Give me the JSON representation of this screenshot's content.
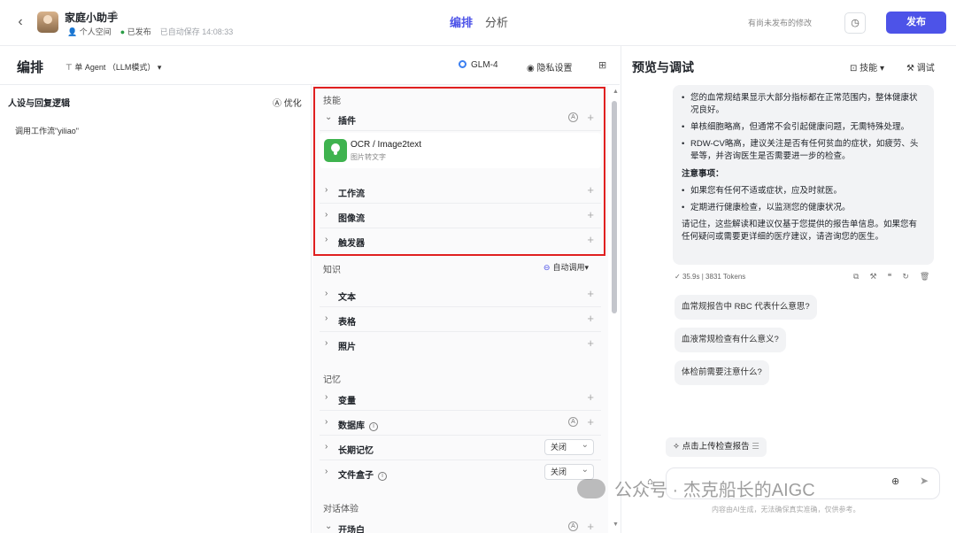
{
  "header": {
    "bot_name": "家庭小助手",
    "space": "个人空间",
    "status": "已发布",
    "autosave": "已自动保存 14:08:33",
    "tabs": [
      "编排",
      "分析"
    ],
    "unsaved_note": "有尚未发布的修改",
    "publish_label": "发布"
  },
  "toolbar": {
    "title": "编排",
    "mode": "单 Agent （LLM模式）",
    "model": "GLM-4",
    "privacy": "隐私设置"
  },
  "persona": {
    "title": "人设与回复逻辑",
    "optimize": "优化",
    "content": "调用工作流\"yiliao\""
  },
  "skills": {
    "skills_label": "技能",
    "plugins_label": "插件",
    "plugin": {
      "name": "OCR / Image2text",
      "desc": "图片转文字"
    },
    "workflow_label": "工作流",
    "imageflow_label": "图像流",
    "trigger_label": "触发器",
    "knowledge_label": "知识",
    "auto_call": "自动调用",
    "text_label": "文本",
    "table_label": "表格",
    "photo_label": "照片",
    "memory_label": "记忆",
    "variable_label": "变量",
    "database_label": "数据库",
    "long_memory_label": "长期记忆",
    "long_memory_value": "关闭",
    "filebox_label": "文件盒子",
    "filebox_value": "关闭",
    "dialog_label": "对话体验",
    "opening_label": "开场白"
  },
  "preview": {
    "title": "预览与调试",
    "skill_btn": "技能",
    "debug_btn": "调试",
    "answer_items": [
      "您的血常规结果显示大部分指标都在正常范围内，整体健康状况良好。",
      "单核细胞略高，但通常不会引起健康问题，无需特殊处理。",
      "RDW-CV略高，建议关注是否有任何贫血的症状，如疲劳、头晕等，并咨询医生是否需要进一步的检查。"
    ],
    "notes_heading": "注意事项：",
    "notes_items": [
      "如果您有任何不适或症状，应及时就医。",
      "定期进行健康检查，以监测您的健康状况。"
    ],
    "closing": "请记住，这些解读和建议仅基于您提供的报告单信息。如果您有任何疑问或需要更详细的医疗建议，请咨询您的医生。",
    "time": "35.9s",
    "tokens": "3831 Tokens",
    "suggestions": [
      "血常规报告中 RBC 代表什么意思?",
      "血液常规检查有什么意义?",
      "体检前需要注意什么?"
    ],
    "upload_chip": "点击上传检查报告",
    "disclaimer": "内容由AI生成，无法确保真实准确，仅供参考。"
  },
  "watermark": "公众号 · 杰克船长的AIGC"
}
